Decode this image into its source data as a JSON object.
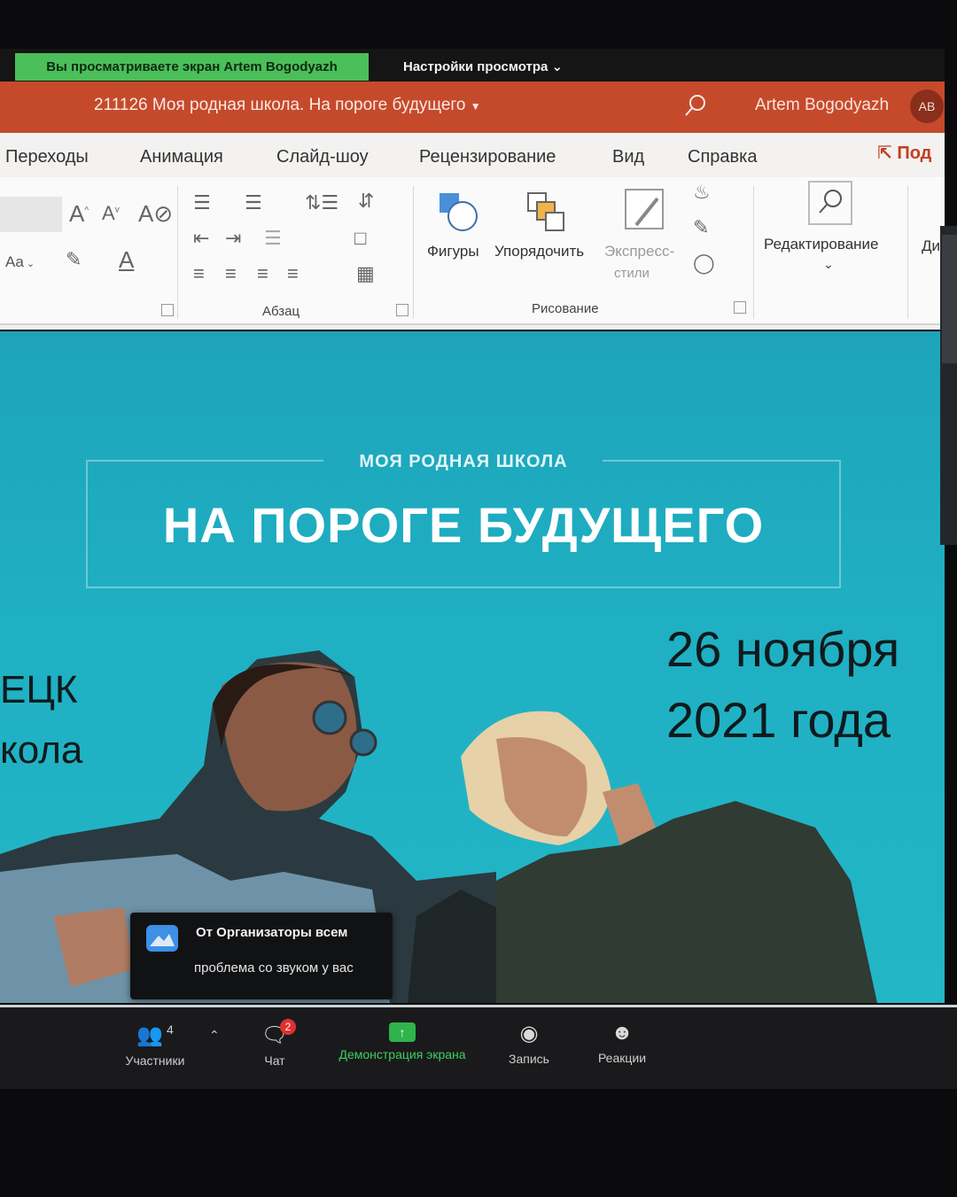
{
  "zoom": {
    "share_banner": "Вы просматриваете экран Artem Bogodyazh",
    "view_settings": "Настройки просмотра",
    "toolbar": {
      "participants_label": "Участники",
      "participants_count": "4",
      "chat_label": "Чат",
      "chat_badge": "2",
      "share_label": "Демонстрация экрана",
      "record_label": "Запись",
      "reactions_label": "Реакции"
    },
    "chat_notification": {
      "from": "От Организаторы всем",
      "message": "проблема со звуком у вас"
    }
  },
  "powerpoint": {
    "document_title": "211126 Моя родная школа. На пороге будущего",
    "user_name": "Artem Bogodyazh",
    "user_initials": "AB",
    "tabs": [
      "Переходы",
      "Анимация",
      "Слайд-шоу",
      "Рецензирование",
      "Вид",
      "Справка"
    ],
    "share_button": "Под",
    "ribbon": {
      "font_group_label": "Aa",
      "paragraph_group_label": "Абзац",
      "drawing_group_label": "Рисование",
      "shapes_label": "Фигуры",
      "arrange_label": "Упорядочить",
      "quick_styles_label_1": "Экспресс-",
      "quick_styles_label_2": "стили",
      "editing_label": "Редактирование",
      "cut_label": "Ди"
    }
  },
  "slide": {
    "subtitle": "МОЯ РОДНАЯ ШКОЛА",
    "title": "НА ПОРОГЕ БУДУЩЕГО",
    "date_line1": "26 ноября",
    "date_line2": "2021 года",
    "left_line1": "ЕЦК",
    "left_line2": "кола"
  },
  "colors": {
    "titlebar": "#c54a2c",
    "slide_bg": "#1fb0c3",
    "share_banner": "#4bbf5a",
    "share_icon": "#2fb34a"
  }
}
